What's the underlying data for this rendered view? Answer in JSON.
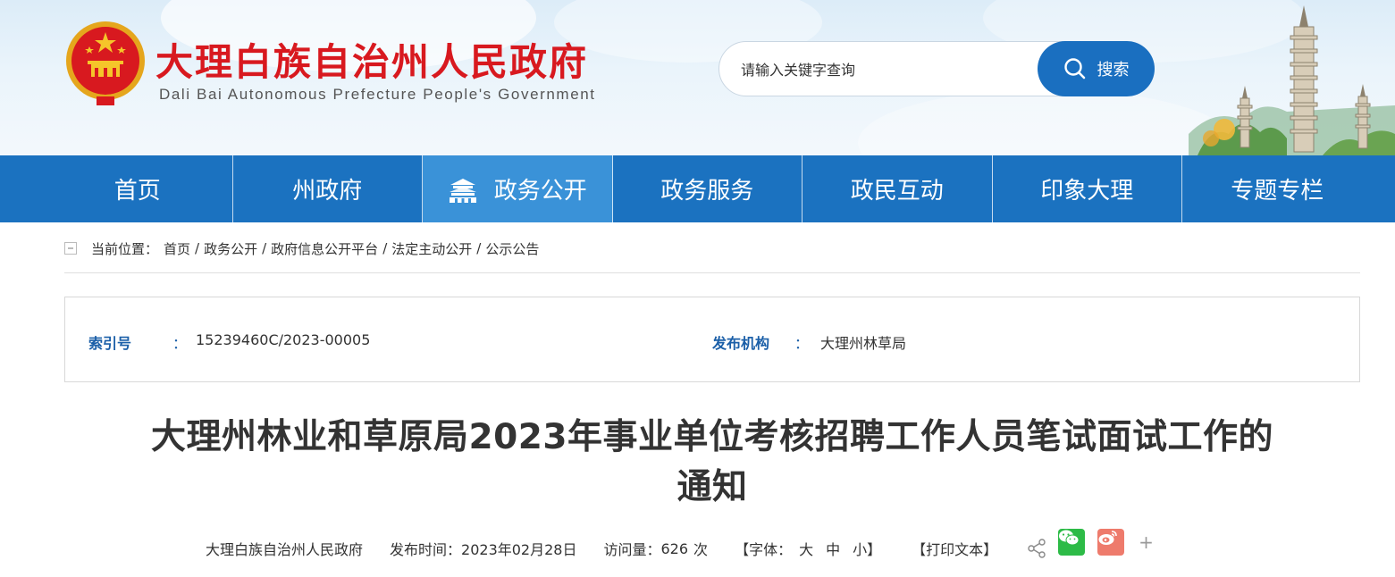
{
  "header": {
    "title": "大理白族自治州人民政府",
    "subtitle": "Dali Bai Autonomous Prefecture People's Government"
  },
  "search": {
    "placeholder": "请输入关键字查询",
    "button_label": "搜索"
  },
  "nav": {
    "items": [
      {
        "label": "首页"
      },
      {
        "label": "州政府"
      },
      {
        "label": "政务公开"
      },
      {
        "label": "政务服务"
      },
      {
        "label": "政民互动"
      },
      {
        "label": "印象大理"
      },
      {
        "label": "专题专栏"
      }
    ],
    "active_index": 2
  },
  "breadcrumb": {
    "prefix": "当前位置：",
    "items": [
      "首页",
      "政务公开",
      "政府信息公开平台",
      "法定主动公开",
      "公示公告"
    ],
    "separator": "/"
  },
  "meta": {
    "index_label": "索引号",
    "index_value": "15239460C/2023-00005",
    "org_label": "发布机构",
    "org_value": "大理州林草局",
    "colon": "："
  },
  "article": {
    "title_line1": "大理州林业和草原局2023年事业单位考核招聘工作人员笔试面试工作的",
    "title_line2": "通知"
  },
  "info": {
    "source": "大理白族自治州人民政府",
    "publish_label": "发布时间：",
    "publish_date": "2023年02月28日",
    "visits_label": "访问量：",
    "visits_value": "626",
    "visits_unit": "次",
    "font_label": "【字体：",
    "font_large": "大",
    "font_medium": "中",
    "font_small": "小",
    "font_end": "】",
    "print_label": "【打印文本】",
    "plus": "+"
  },
  "colors": {
    "brand_red": "#d8191f",
    "nav_blue": "#1b72c0",
    "nav_active": "#3a92d8",
    "label_blue": "#1b5fa8",
    "wechat_green": "#2dbb47",
    "weibo_red": "#ee7b6c"
  }
}
